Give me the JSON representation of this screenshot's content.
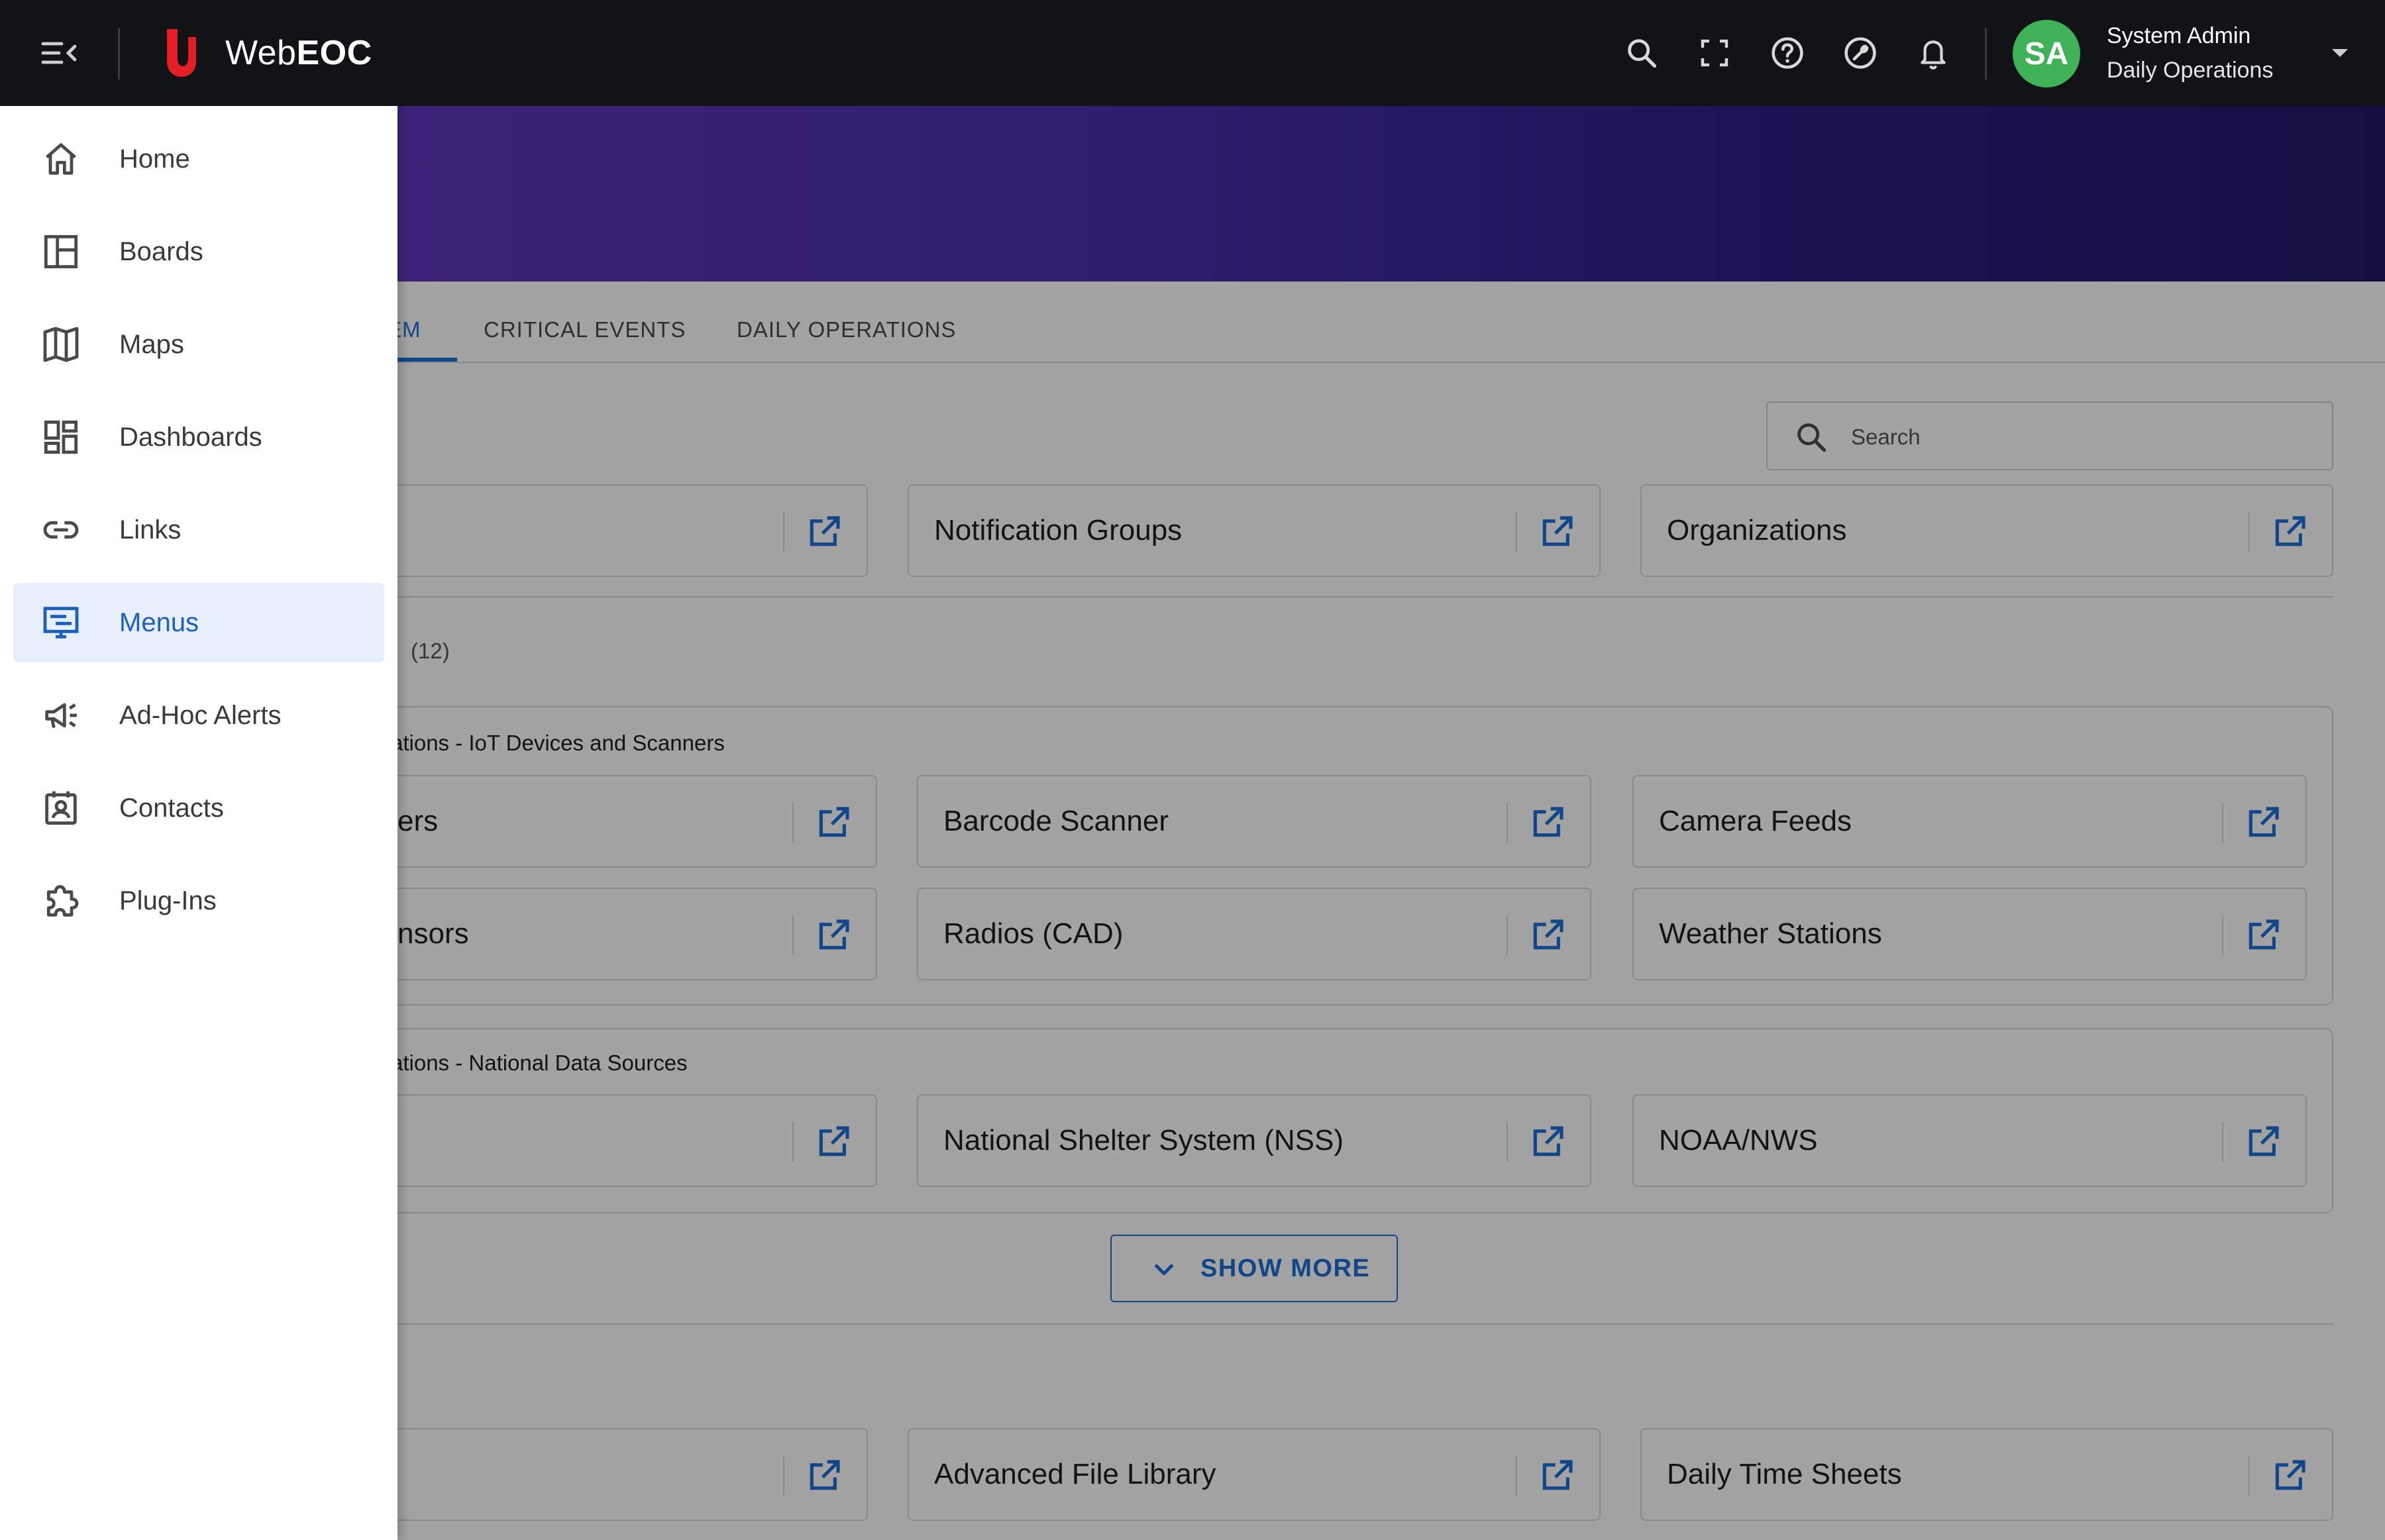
{
  "app": {
    "brand_prefix": "Web",
    "brand_suffix": "EOC"
  },
  "user": {
    "initials": "SA",
    "name": "System Admin",
    "position": "Daily Operations"
  },
  "topbar_icons": [
    "search-icon",
    "fullscreen-icon",
    "help-icon",
    "tools-icon",
    "bell-icon"
  ],
  "colors": {
    "topbar": "#121316",
    "accent": "#1b6fd6",
    "avatar": "#3fb257",
    "brand_red": "#e31e24"
  },
  "tabs": [
    {
      "label": "EM",
      "active": true
    },
    {
      "label": "CRITICAL EVENTS",
      "active": false
    },
    {
      "label": "DAILY OPERATIONS",
      "active": false
    }
  ],
  "search": {
    "placeholder": "Search"
  },
  "top_cards": [
    "",
    "Notification Groups",
    "Organizations"
  ],
  "section_count": "(12)",
  "groups": [
    {
      "title": "ations - IoT Devices and Scanners",
      "cards": [
        "ers",
        "Barcode Scanner",
        "Camera Feeds",
        "nsors",
        "Radios (CAD)",
        "Weather Stations"
      ]
    },
    {
      "title": "ations - National Data Sources",
      "cards": [
        "",
        "National Shelter System (NSS)",
        "NOAA/NWS"
      ]
    }
  ],
  "show_more": "SHOW MORE",
  "bottom_cards": [
    "",
    "Advanced File Library",
    "Daily Time Sheets"
  ],
  "drawer": {
    "items": [
      {
        "label": "Home",
        "icon": "home-icon",
        "active": false
      },
      {
        "label": "Boards",
        "icon": "boards-icon",
        "active": false
      },
      {
        "label": "Maps",
        "icon": "map-icon",
        "active": false
      },
      {
        "label": "Dashboards",
        "icon": "dashboard-icon",
        "active": false
      },
      {
        "label": "Links",
        "icon": "link-icon",
        "active": false
      },
      {
        "label": "Menus",
        "icon": "menus-icon",
        "active": true
      },
      {
        "label": "Ad-Hoc Alerts",
        "icon": "megaphone-icon",
        "active": false
      },
      {
        "label": "Contacts",
        "icon": "contacts-icon",
        "active": false
      },
      {
        "label": "Plug-Ins",
        "icon": "puzzle-icon",
        "active": false
      }
    ]
  }
}
